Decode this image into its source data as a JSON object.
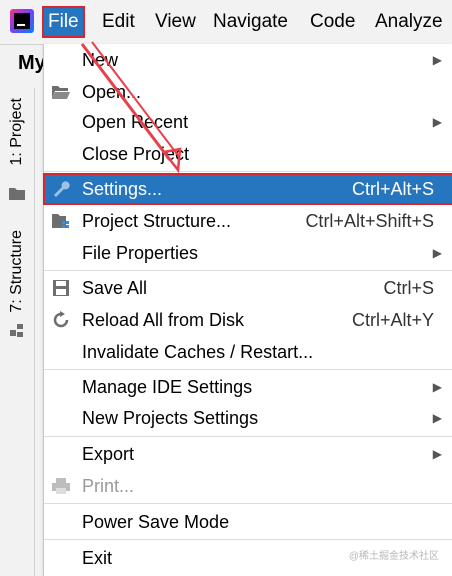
{
  "menubar": {
    "items": [
      {
        "label": "File",
        "active": true
      },
      {
        "label": "Edit"
      },
      {
        "label": "View"
      },
      {
        "label": "Navigate"
      },
      {
        "label": "Code"
      },
      {
        "label": "Analyze"
      }
    ]
  },
  "project_title": "My",
  "toolwindows": [
    {
      "label": "1: Project"
    },
    {
      "label": "7: Structure"
    }
  ],
  "file_menu": {
    "items": [
      {
        "label": "New",
        "submenu": true
      },
      {
        "label": "Open...",
        "icon": "folder-open-icon"
      },
      {
        "label": "Open Recent",
        "submenu": true
      },
      {
        "label": "Close Project"
      },
      {
        "label": "Settings...",
        "shortcut": "Ctrl+Alt+S",
        "icon": "wrench-icon",
        "selected": true
      },
      {
        "label": "Project Structure...",
        "shortcut": "Ctrl+Alt+Shift+S",
        "icon": "project-structure-icon"
      },
      {
        "label": "File Properties",
        "submenu": true
      },
      {
        "label": "Save All",
        "shortcut": "Ctrl+S",
        "icon": "save-icon"
      },
      {
        "label": "Reload All from Disk",
        "shortcut": "Ctrl+Alt+Y",
        "icon": "reload-icon"
      },
      {
        "label": "Invalidate Caches / Restart..."
      },
      {
        "label": "Manage IDE Settings",
        "submenu": true
      },
      {
        "label": "New Projects Settings",
        "submenu": true
      },
      {
        "label": "Export",
        "submenu": true
      },
      {
        "label": "Print...",
        "icon": "print-icon",
        "disabled": true
      },
      {
        "label": "Power Save Mode"
      },
      {
        "label": "Exit"
      }
    ]
  },
  "watermark": "@稀土掘金技术社区",
  "colors": {
    "selection": "#2675bf",
    "highlight_border": "#d9262e"
  }
}
